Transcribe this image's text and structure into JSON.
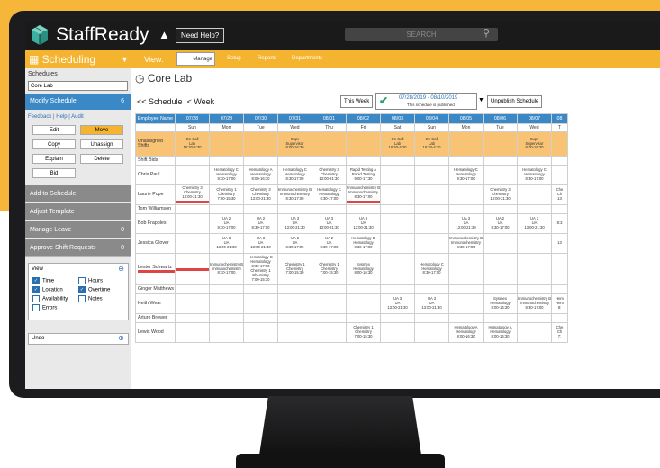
{
  "app": {
    "name": "StaffReady",
    "need_help": "Need Help?",
    "search_placeholder": "SEARCH"
  },
  "nav": {
    "scheduling": "Scheduling",
    "view_label": "View:",
    "items": [
      "Manage",
      "Setup",
      "Reports",
      "Departments"
    ]
  },
  "sidebar": {
    "schedules_label": "Schedules",
    "selected_schedule": "Core Lab",
    "modify_schedule": "Modify Schedule",
    "modify_count": "6",
    "links": [
      "Feedback",
      "Help",
      "Audit"
    ],
    "buttons": [
      "Edit",
      "Move",
      "Copy",
      "Unassign",
      "Explain",
      "Delete",
      "Bid"
    ],
    "actions": [
      {
        "label": "Add to Schedule",
        "count": ""
      },
      {
        "label": "Adjust Template",
        "count": ""
      },
      {
        "label": "Manage Leave",
        "count": "0"
      },
      {
        "label": "Approve Shift Requests",
        "count": "0"
      }
    ],
    "view_panel": {
      "title": "View",
      "options": [
        {
          "label": "Time",
          "checked": true
        },
        {
          "label": "Hours",
          "checked": false
        },
        {
          "label": "Location",
          "checked": true
        },
        {
          "label": "Overtime",
          "checked": true
        },
        {
          "label": "Availability",
          "checked": false
        },
        {
          "label": "Notes",
          "checked": false
        },
        {
          "label": "Errors",
          "checked": false
        }
      ]
    },
    "undo_label": "Undo"
  },
  "main": {
    "title": "Core Lab",
    "prev_schedule": "<< Schedule",
    "prev_week": "< Week",
    "this_week": "This Week",
    "date_range": "07/28/2019 - 08/10/2019",
    "published_note": "This schedule is published",
    "unpublish": "Unpublish Schedule"
  },
  "grid": {
    "header_label": "Employee Name",
    "dates": [
      "07/28",
      "07/29",
      "07/30",
      "07/31",
      "08/01",
      "08/02",
      "08/03",
      "08/04",
      "08/05",
      "08/06",
      "08/07",
      "08"
    ],
    "days": [
      "Sun",
      "Mon",
      "Tue",
      "Wed",
      "Thu",
      "Fri",
      "Sat",
      "Sun",
      "Mon",
      "Tue",
      "Wed",
      "T"
    ],
    "rows": [
      {
        "name": "Unassigned Shifts",
        "type": "unassigned",
        "cells": [
          [
            "On Call",
            "Lab",
            "16:30-4:30"
          ],
          [],
          [],
          [
            "Supv",
            "Supervisor",
            "8:00-16:30"
          ],
          [],
          [],
          [
            "On Call",
            "Lab",
            "16:30-4:30"
          ],
          [
            "On Call",
            "Lab",
            "16:30-4:30"
          ],
          [],
          [],
          [
            "Supv",
            "Supervisor",
            "8:00-16:30"
          ],
          []
        ]
      },
      {
        "name": "Shift Bids",
        "type": "bids",
        "cells": [
          [],
          [],
          [],
          [],
          [],
          [],
          [],
          [],
          [],
          [],
          [],
          []
        ]
      },
      {
        "name": "Chris Paul",
        "cells": [
          [],
          [
            "Hematology C",
            "Hematology",
            "8:30-17:00"
          ],
          [
            "Hematology A",
            "Hematology",
            "8:00-16:30"
          ],
          [
            "Hematology C",
            "Hematology",
            "8:30-17:00"
          ],
          [
            "Chemistry 3",
            "Chemistry",
            "13:00-21:30"
          ],
          [
            "Rapid Testing A",
            "Rapid Testing",
            "9:00-17:30"
          ],
          [],
          [],
          [
            "Hematology C",
            "Hematology",
            "8:30-17:00"
          ],
          [],
          [
            "Hematology C",
            "Hematology",
            "8:30-17:00"
          ],
          []
        ]
      },
      {
        "name": "Laurie Pope",
        "redcells": [
          0,
          5
        ],
        "cells": [
          [
            "Chemistry 3",
            "Chemistry",
            "13:00-21:30"
          ],
          [
            "Chemistry 1",
            "Chemistry",
            "7:00-15:30"
          ],
          [
            "Chemistry 3",
            "Chemistry",
            "13:00-21:30"
          ],
          [
            "Immunochemistry B",
            "Immunochemistry",
            "8:30-17:00"
          ],
          [
            "Hematology C",
            "Hematology",
            "8:30-17:00"
          ],
          [
            "Immunochemistry B",
            "Immunochemistry",
            "8:30-17:00"
          ],
          [],
          [],
          [],
          [
            "Chemistry 3",
            "Chemistry",
            "13:00-21:30"
          ],
          [],
          [
            "Che",
            "Ch",
            "13"
          ]
        ]
      },
      {
        "name": "Tom Williamson",
        "cells": [
          [],
          [],
          [],
          [],
          [],
          [],
          [],
          [],
          [],
          [],
          [],
          []
        ]
      },
      {
        "name": "Bob Frapples",
        "cells": [
          [],
          [
            "UA 2",
            "UA",
            "8:30-17:00"
          ],
          [
            "UA 2",
            "UA",
            "8:30-17:00"
          ],
          [
            "UA 3",
            "UA",
            "13:00-21:30"
          ],
          [
            "UA 3",
            "UA",
            "13:00-21:30"
          ],
          [
            "UA 3",
            "UA",
            "13:00-21:30"
          ],
          [],
          [],
          [
            "UA 3",
            "UA",
            "13:00-21:30"
          ],
          [
            "UA 2",
            "UA",
            "8:30-17:00"
          ],
          [
            "UA 3",
            "UA",
            "13:00-21:30"
          ],
          [
            "",
            "",
            "8:3"
          ]
        ]
      },
      {
        "name": "Jessica Glover",
        "cells": [
          [],
          [
            "UA 3",
            "UA",
            "13:00-21:30"
          ],
          [
            "UA 3",
            "UA",
            "13:00-21:30"
          ],
          [
            "UA 2",
            "UA",
            "8:30-17:00"
          ],
          [
            "UA 2",
            "UA",
            "8:30-17:00"
          ],
          [
            "Hematology B",
            "Hematology",
            "8:30-17:00"
          ],
          [],
          [],
          [
            "Immunochemistry B",
            "Immunochemistry",
            "8:30-17:00"
          ],
          [],
          [],
          [
            "",
            "",
            "13"
          ]
        ]
      },
      {
        "name": "Lester Schwartz",
        "type": "tall",
        "redcells": [
          0
        ],
        "cells": [
          [],
          [
            "Immunochemistry B",
            "Immunochemistry",
            "8:30-17:00"
          ],
          [
            "Hematology C",
            "Hematology",
            "8:30-17:00",
            "Chemistry 1",
            "Chemistry",
            "7:00-15:30"
          ],
          [
            "Chemistry 1",
            "Chemistry",
            "7:00-15:30"
          ],
          [
            "Chemistry 1",
            "Chemistry",
            "7:00-15:30"
          ],
          [
            "Sysmex",
            "Hematology",
            "8:00-16:30"
          ],
          [],
          [
            "Hematology C",
            "Hematology",
            "8:30-17:00"
          ],
          [],
          [],
          [],
          []
        ]
      },
      {
        "name": "Ginger Matthews",
        "cells": [
          [],
          [],
          [],
          [],
          [],
          [],
          [],
          [],
          [],
          [],
          [],
          []
        ]
      },
      {
        "name": "Keith Wear",
        "cells": [
          [],
          [],
          [],
          [],
          [],
          [],
          [
            "UA 3",
            "UA",
            "13:00-21:30"
          ],
          [
            "UA 3",
            "UA",
            "13:00-21:30"
          ],
          [],
          [
            "Sysmex",
            "Hematology",
            "8:00-16:30"
          ],
          [
            "Immunochemistry B",
            "Immunochemistry",
            "8:30-17:00"
          ],
          [
            "Hem",
            "Hem",
            "8:"
          ]
        ]
      },
      {
        "name": "Arturo Brewer",
        "cells": [
          [],
          [],
          [],
          [],
          [],
          [],
          [],
          [],
          [],
          [],
          [],
          []
        ]
      },
      {
        "name": "Lewis Wood",
        "cells": [
          [],
          [],
          [],
          [],
          [],
          [
            "Chemistry 1",
            "Chemistry",
            "7:00-15:30"
          ],
          [],
          [],
          [
            "Hematology A",
            "Hematology",
            "8:00-16:30"
          ],
          [
            "Hematology A",
            "Hematology",
            "8:00-16:30"
          ],
          [],
          [
            "Che",
            "Ch",
            "7:"
          ]
        ]
      }
    ]
  },
  "colors": {
    "accent": "#f5b430",
    "header_blue": "#3b88c6",
    "unassigned": "#f8c374",
    "alert_red": "#e04545"
  }
}
